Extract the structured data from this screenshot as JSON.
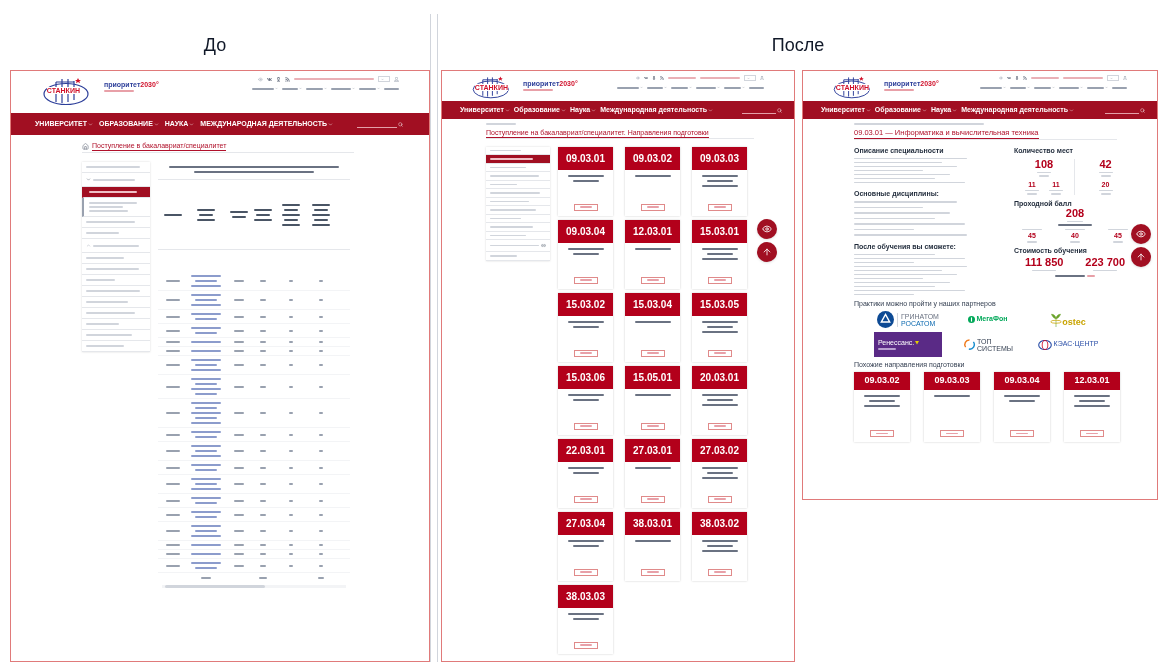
{
  "captions": {
    "before": "До",
    "after": "После"
  },
  "before": {
    "header": {
      "logo_text": "СТАНКИН",
      "partner_logo": "приоритет",
      "partner_logo_year": "2030°",
      "main_nav": [
        "УНИВЕРСИТЕТ",
        "ОБРАЗОВАНИЕ",
        "НАУКА",
        "МЕЖДУНАРОДНАЯ ДЕЯТЕЛЬНОСТЬ"
      ]
    },
    "page_title": "Поступление в бакалавриат/специалитет",
    "sidebar": [
      {
        "selected": false
      },
      {
        "selected": false,
        "expanded": true,
        "children": [
          {
            "selected": true
          },
          {
            "selected": false
          }
        ]
      },
      {
        "selected": false
      },
      {
        "selected": false
      },
      {
        "selected": false,
        "expanded": false
      },
      {
        "selected": false
      },
      {
        "selected": false
      },
      {
        "selected": false
      },
      {
        "selected": false
      },
      {
        "selected": false
      },
      {
        "selected": false
      },
      {
        "selected": false
      },
      {
        "selected": false
      },
      {
        "selected": false
      }
    ]
  },
  "after_list": {
    "header": {
      "logo_text": "СТАНКИН",
      "partner_logo": "приоритет",
      "partner_logo_year": "2030°",
      "main_nav": [
        "Университет",
        "Образование",
        "Наука",
        "Международная деятельность"
      ]
    },
    "title": "Поступление на бакалавриат/специалитет. Направления подготовки",
    "sidebar": [
      {
        "selected": false,
        "external": false
      },
      {
        "selected": true,
        "external": false
      },
      {
        "selected": false,
        "external": false
      },
      {
        "selected": false,
        "external": false
      },
      {
        "selected": false,
        "external": false
      },
      {
        "selected": false,
        "external": false
      },
      {
        "selected": false,
        "external": false
      },
      {
        "selected": false,
        "external": false
      },
      {
        "selected": false,
        "external": false
      },
      {
        "selected": false,
        "external": false
      },
      {
        "selected": false,
        "external": false
      },
      {
        "selected": false,
        "external": true
      },
      {
        "selected": false,
        "external": false
      }
    ],
    "cards": [
      {
        "code": "09.03.01"
      },
      {
        "code": "09.03.02"
      },
      {
        "code": "09.03.03"
      },
      {
        "code": "09.03.04"
      },
      {
        "code": "12.03.01"
      },
      {
        "code": "15.03.01"
      },
      {
        "code": "15.03.02"
      },
      {
        "code": "15.03.04"
      },
      {
        "code": "15.03.05"
      },
      {
        "code": "15.03.06"
      },
      {
        "code": "15.05.01"
      },
      {
        "code": "20.03.01"
      },
      {
        "code": "22.03.01"
      },
      {
        "code": "27.03.01"
      },
      {
        "code": "27.03.02"
      },
      {
        "code": "27.03.04"
      },
      {
        "code": "38.03.01"
      },
      {
        "code": "38.03.02"
      },
      {
        "code": "38.03.03"
      }
    ]
  },
  "after_detail": {
    "header": {
      "logo_text": "СТАНКИН",
      "partner_logo": "приоритет",
      "partner_logo_year": "2030°",
      "main_nav": [
        "Университет",
        "Образование",
        "Наука",
        "Международная деятельность"
      ]
    },
    "title": "09.03.01 — Информатика и вычислительная техника",
    "description_heading": "Описание специальности",
    "disciplines_heading": "Основные дисциплины:",
    "outcomes_heading": "После обучения вы сможете:",
    "places": {
      "heading": "Количество мест",
      "budget": "108",
      "contract": "42",
      "quota": "11",
      "target": "11",
      "foreign": "20"
    },
    "passing": {
      "heading": "Проходной балл",
      "value": "208",
      "scores": [
        "45",
        "40",
        "45"
      ]
    },
    "cost": {
      "heading": "Стоимость обучения",
      "values": [
        "111 850",
        "223 700"
      ]
    },
    "partners": {
      "heading": "Практики можно пройти у наших партнеров",
      "items": [
        {
          "kind": "rosatom",
          "lines": [
            "ГРИНАТОМ",
            "РОСАТОМ"
          ]
        },
        {
          "kind": "megafon",
          "lines": [
            "МегаФон"
          ]
        },
        {
          "kind": "ostec",
          "lines": [
            "ostec"
          ]
        },
        {
          "kind": "renaissance",
          "lines": [
            "Ренессанс."
          ]
        },
        {
          "kind": "topsystems",
          "lines": [
            "ТОП",
            "СИСТЕМЫ"
          ]
        },
        {
          "kind": "keas",
          "lines": [
            "КЭАС·ЦЕНТР"
          ]
        }
      ]
    },
    "similar": {
      "heading": "Похожие направления подготовки",
      "cards": [
        {
          "code": "09.03.02"
        },
        {
          "code": "09.03.03"
        },
        {
          "code": "09.03.04"
        },
        {
          "code": "12.03.01"
        }
      ]
    }
  }
}
